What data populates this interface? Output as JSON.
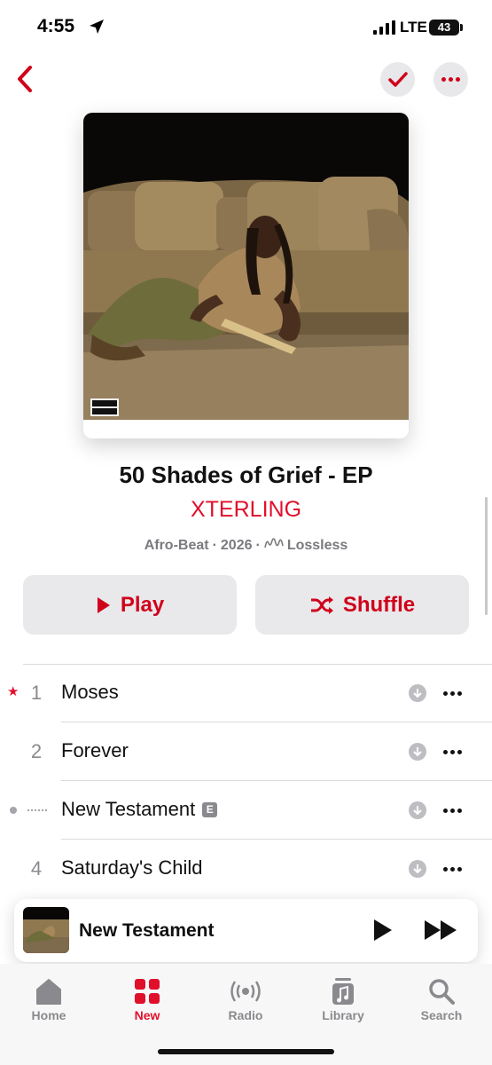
{
  "status_bar": {
    "time": "4:55",
    "network": "LTE",
    "battery": "43"
  },
  "album": {
    "title": "50 Shades of Grief - EP",
    "artist": "XTERLING",
    "genre": "Afro-Beat",
    "year": "2026",
    "quality": "Lossless",
    "separator": "·",
    "advisory_label": "PARENTAL ADVISORY EXPLICIT CONTENT"
  },
  "actions": {
    "play_label": "Play",
    "shuffle_label": "Shuffle"
  },
  "tracks": [
    {
      "number": "1",
      "title": "Moses",
      "favorite": true,
      "explicit": false
    },
    {
      "number": "2",
      "title": "Forever",
      "favorite": false,
      "explicit": false
    },
    {
      "number": "",
      "title": "New Testament",
      "favorite": false,
      "explicit": true,
      "explicit_badge": "E",
      "now_playing": true
    },
    {
      "number": "4",
      "title": "Saturday's Child",
      "favorite": false,
      "explicit": false
    }
  ],
  "mini_player": {
    "title": "New Testament"
  },
  "tab_bar": {
    "items": [
      {
        "label": "Home",
        "icon": "house-icon",
        "active": false
      },
      {
        "label": "New",
        "icon": "grid-icon",
        "active": true
      },
      {
        "label": "Radio",
        "icon": "radio-waves-icon",
        "active": false
      },
      {
        "label": "Library",
        "icon": "music-library-icon",
        "active": false
      },
      {
        "label": "Search",
        "icon": "magnifier-icon",
        "active": false
      }
    ]
  },
  "colors": {
    "accent": "#e0102b",
    "button_bg": "#e9e9eb",
    "secondary_text": "#8a8a8e"
  }
}
